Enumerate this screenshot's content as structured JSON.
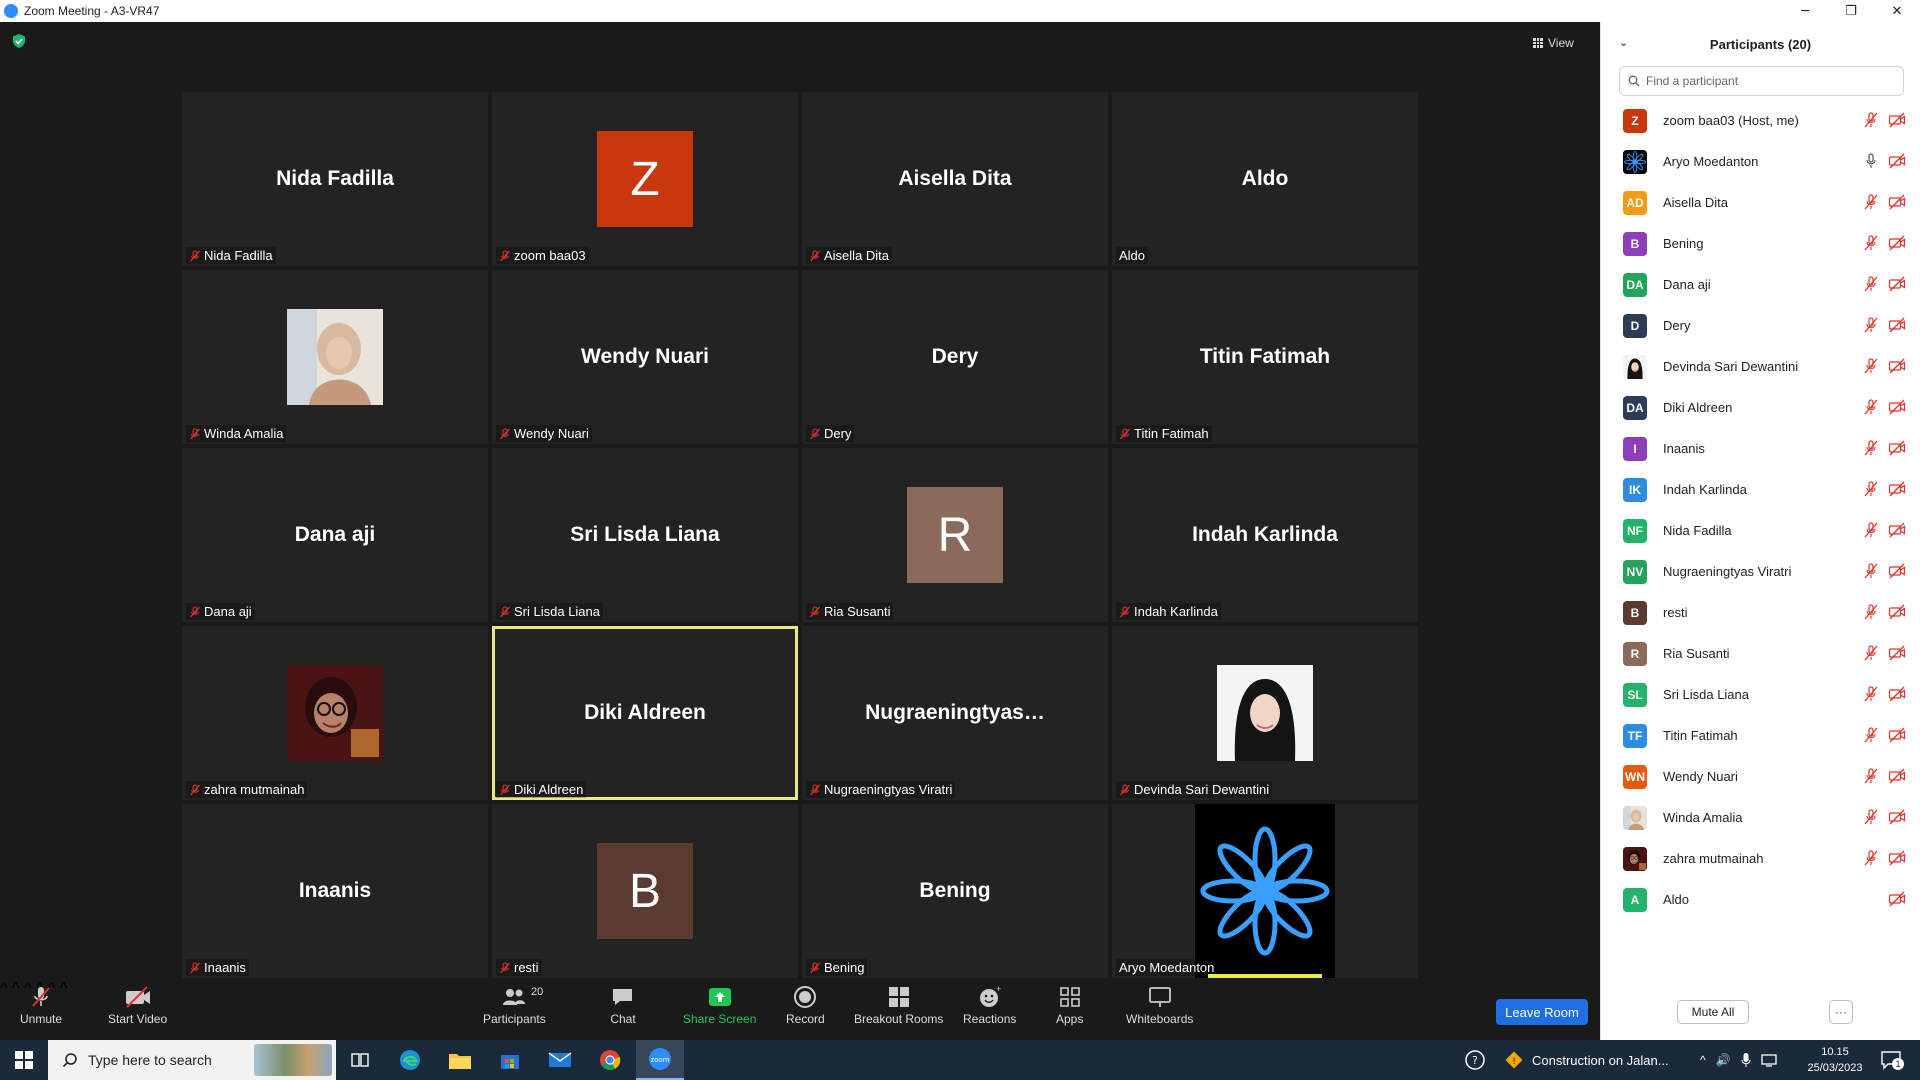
{
  "window": {
    "title": "Zoom Meeting - A3-VR47"
  },
  "meeting": {
    "view_label": "View",
    "tiles": [
      {
        "type": "name",
        "display": "Nida Fadilla",
        "label": "Nida Fadilla",
        "muted": true
      },
      {
        "type": "letter",
        "display": "Z",
        "bg": "#c9370f",
        "label": "zoom baa03",
        "muted": true
      },
      {
        "type": "name",
        "display": "Aisella Dita",
        "label": "Aisella Dita",
        "muted": true
      },
      {
        "type": "name",
        "display": "Aldo",
        "label": "Aldo",
        "muted": false
      },
      {
        "type": "photo",
        "photo": "hijab-selfie",
        "label": "Winda Amalia",
        "muted": true
      },
      {
        "type": "name",
        "display": "Wendy Nuari",
        "label": "Wendy Nuari",
        "muted": true
      },
      {
        "type": "name",
        "display": "Dery",
        "label": "Dery",
        "muted": true
      },
      {
        "type": "name",
        "display": "Titin Fatimah",
        "label": "Titin Fatimah",
        "muted": true
      },
      {
        "type": "name",
        "display": "Dana aji",
        "label": "Dana aji",
        "muted": true
      },
      {
        "type": "name",
        "display": "Sri Lisda Liana",
        "label": "Sri Lisda Liana",
        "muted": true
      },
      {
        "type": "letter",
        "display": "R",
        "bg": "#8b6a5c",
        "label": "Ria Susanti",
        "muted": true
      },
      {
        "type": "name",
        "display": "Indah Karlinda",
        "label": "Indah Karlinda",
        "muted": true
      },
      {
        "type": "photo",
        "photo": "glasses-selfie",
        "label": "zahra mutmainah",
        "muted": true
      },
      {
        "type": "name",
        "display": "Diki Aldreen",
        "label": "Diki Aldreen",
        "muted": true,
        "active": true
      },
      {
        "type": "name",
        "display": "Nugraeningtyas…",
        "label": "Nugraeningtyas Viratri",
        "muted": true
      },
      {
        "type": "photo",
        "photo": "hijab-portrait",
        "label": "Devinda Sari Dewantini",
        "muted": true
      },
      {
        "type": "name",
        "display": "Inaanis",
        "label": "Inaanis",
        "muted": true
      },
      {
        "type": "letter",
        "display": "B",
        "bg": "#5b3a30",
        "label": "resti",
        "muted": true
      },
      {
        "type": "name",
        "display": "Bening",
        "label": "Bening",
        "muted": true
      },
      {
        "type": "logo",
        "photo": "blue-flower-logo",
        "label": "Aryo Moedanton",
        "muted": false,
        "speaking": true
      }
    ]
  },
  "toolbar": {
    "unmute": "Unmute",
    "start_video": "Start Video",
    "participants": "Participants",
    "participants_count": "20",
    "chat": "Chat",
    "share_screen": "Share Screen",
    "record": "Record",
    "breakout_rooms": "Breakout Rooms",
    "reactions": "Reactions",
    "apps": "Apps",
    "whiteboards": "Whiteboards",
    "leave_room": "Leave Room"
  },
  "panel": {
    "title": "Participants (20)",
    "search_placeholder": "Find a participant",
    "mute_all": "Mute All",
    "more": "···",
    "participants": [
      {
        "name": "zoom baa03 (Host, me)",
        "initials": "Z",
        "color": "#c9370f",
        "mic": "muted",
        "video": "off"
      },
      {
        "name": "Aryo Moedanton",
        "initials": "",
        "color": "#0a1a3a",
        "avatar": "blue-flower-logo",
        "mic": "on",
        "video": "off"
      },
      {
        "name": "Aisella Dita",
        "initials": "AD",
        "color": "#f29b13",
        "mic": "muted",
        "video": "off"
      },
      {
        "name": "Bening",
        "initials": "B",
        "color": "#8e3fb8",
        "mic": "muted",
        "video": "off"
      },
      {
        "name": "Dana aji",
        "initials": "DA",
        "color": "#23a45a",
        "mic": "muted",
        "video": "off"
      },
      {
        "name": "Dery",
        "initials": "D",
        "color": "#2e3d55",
        "mic": "muted",
        "video": "off"
      },
      {
        "name": "Devinda Sari Dewantini",
        "initials": "",
        "color": "#d9d9d9",
        "avatar": "hijab-portrait",
        "mic": "muted",
        "video": "off"
      },
      {
        "name": "Diki Aldreen",
        "initials": "DA",
        "color": "#2e3d55",
        "mic": "muted",
        "video": "off"
      },
      {
        "name": "Inaanis",
        "initials": "I",
        "color": "#8e3fb8",
        "mic": "muted",
        "video": "off"
      },
      {
        "name": "Indah Karlinda",
        "initials": "IK",
        "color": "#2b8ce0",
        "mic": "muted",
        "video": "off"
      },
      {
        "name": "Nida Fadilla",
        "initials": "NF",
        "color": "#23b36a",
        "mic": "muted",
        "video": "off"
      },
      {
        "name": "Nugraeningtyas Viratri",
        "initials": "NV",
        "color": "#23a45a",
        "mic": "muted",
        "video": "off"
      },
      {
        "name": "resti",
        "initials": "B",
        "color": "#5b3a30",
        "mic": "muted",
        "video": "off"
      },
      {
        "name": "Ria Susanti",
        "initials": "R",
        "color": "#8b6a5c",
        "mic": "muted",
        "video": "off"
      },
      {
        "name": "Sri Lisda Liana",
        "initials": "SL",
        "color": "#23b36a",
        "mic": "muted",
        "video": "off"
      },
      {
        "name": "Titin Fatimah",
        "initials": "TF",
        "color": "#2b8ce0",
        "mic": "muted",
        "video": "off"
      },
      {
        "name": "Wendy Nuari",
        "initials": "WN",
        "color": "#e65a10",
        "mic": "muted",
        "video": "off"
      },
      {
        "name": "Winda Amalia",
        "initials": "",
        "color": "#c8b8a8",
        "avatar": "hijab-selfie",
        "mic": "muted",
        "video": "off"
      },
      {
        "name": "zahra mutmainah",
        "initials": "",
        "color": "#5a1b1b",
        "avatar": "glasses-selfie",
        "mic": "muted",
        "video": "off"
      },
      {
        "name": "Aldo",
        "initials": "A",
        "color": "#23b36a",
        "mic": "none",
        "video": "off"
      }
    ]
  },
  "taskbar": {
    "search_placeholder": "Type here to search",
    "news_text": "Construction on Jalan...",
    "time": "10.15",
    "date": "25/03/2023",
    "notification_count": "1"
  },
  "colors": {
    "active_speaker": "#e6e88a",
    "accent": "#1f6fe0",
    "share_green": "#23c552",
    "muted_red": "#e0322a"
  }
}
